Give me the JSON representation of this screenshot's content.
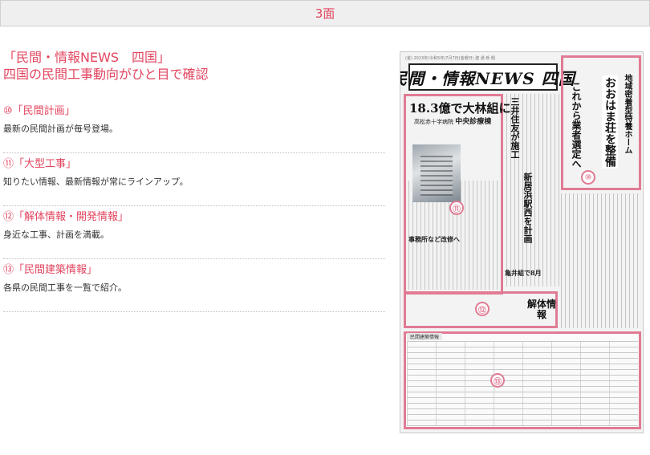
{
  "header": {
    "title": "3面"
  },
  "intro": {
    "title_line1": "「民間・情報NEWS　四国」",
    "title_line2": "四国の民間工事動向がひと目で確認"
  },
  "sections": [
    {
      "heading": "⑩「民間計画」",
      "text": "最新の民間計画が毎号登場。"
    },
    {
      "heading": "⑪「大型工事」",
      "text": "知りたい情報、最新情報が常にラインアップ。"
    },
    {
      "heading": "⑫「解体情報・開発情報」",
      "text": "身近な工事、計画を満載。"
    },
    {
      "heading": "⑬「民間建築情報」",
      "text": "各県の民間工事を一覧で紹介。"
    }
  ],
  "newspaper": {
    "masthead": "民間・情報NEWS 四国",
    "top_line": "(金) 2023年(令和5年)7月7日(金曜日) 建 通 新 聞",
    "big_headline": "18.3億で大林組に",
    "sub_headline_small": "高松赤十字病院",
    "sub_headline_big": "中央診療棟",
    "vertical_1": "おおはま荘を整備",
    "vertical_2": "地域密着型特養ホーム",
    "vertical_3": "これから業者選定へ",
    "vertical_4": "三井住友が施工",
    "vertical_5": "新居浜駅西を計画",
    "mid_heading": "事務所など改修へ",
    "mid_heading2": "亀井組で8月",
    "kaitai": "解体情報",
    "bottom_title": "民間建築情報",
    "badges": [
      "⑩",
      "⑪",
      "⑫",
      "⑬"
    ]
  },
  "colors": {
    "accent": "#e2455f",
    "highlight": "#e07b93"
  }
}
